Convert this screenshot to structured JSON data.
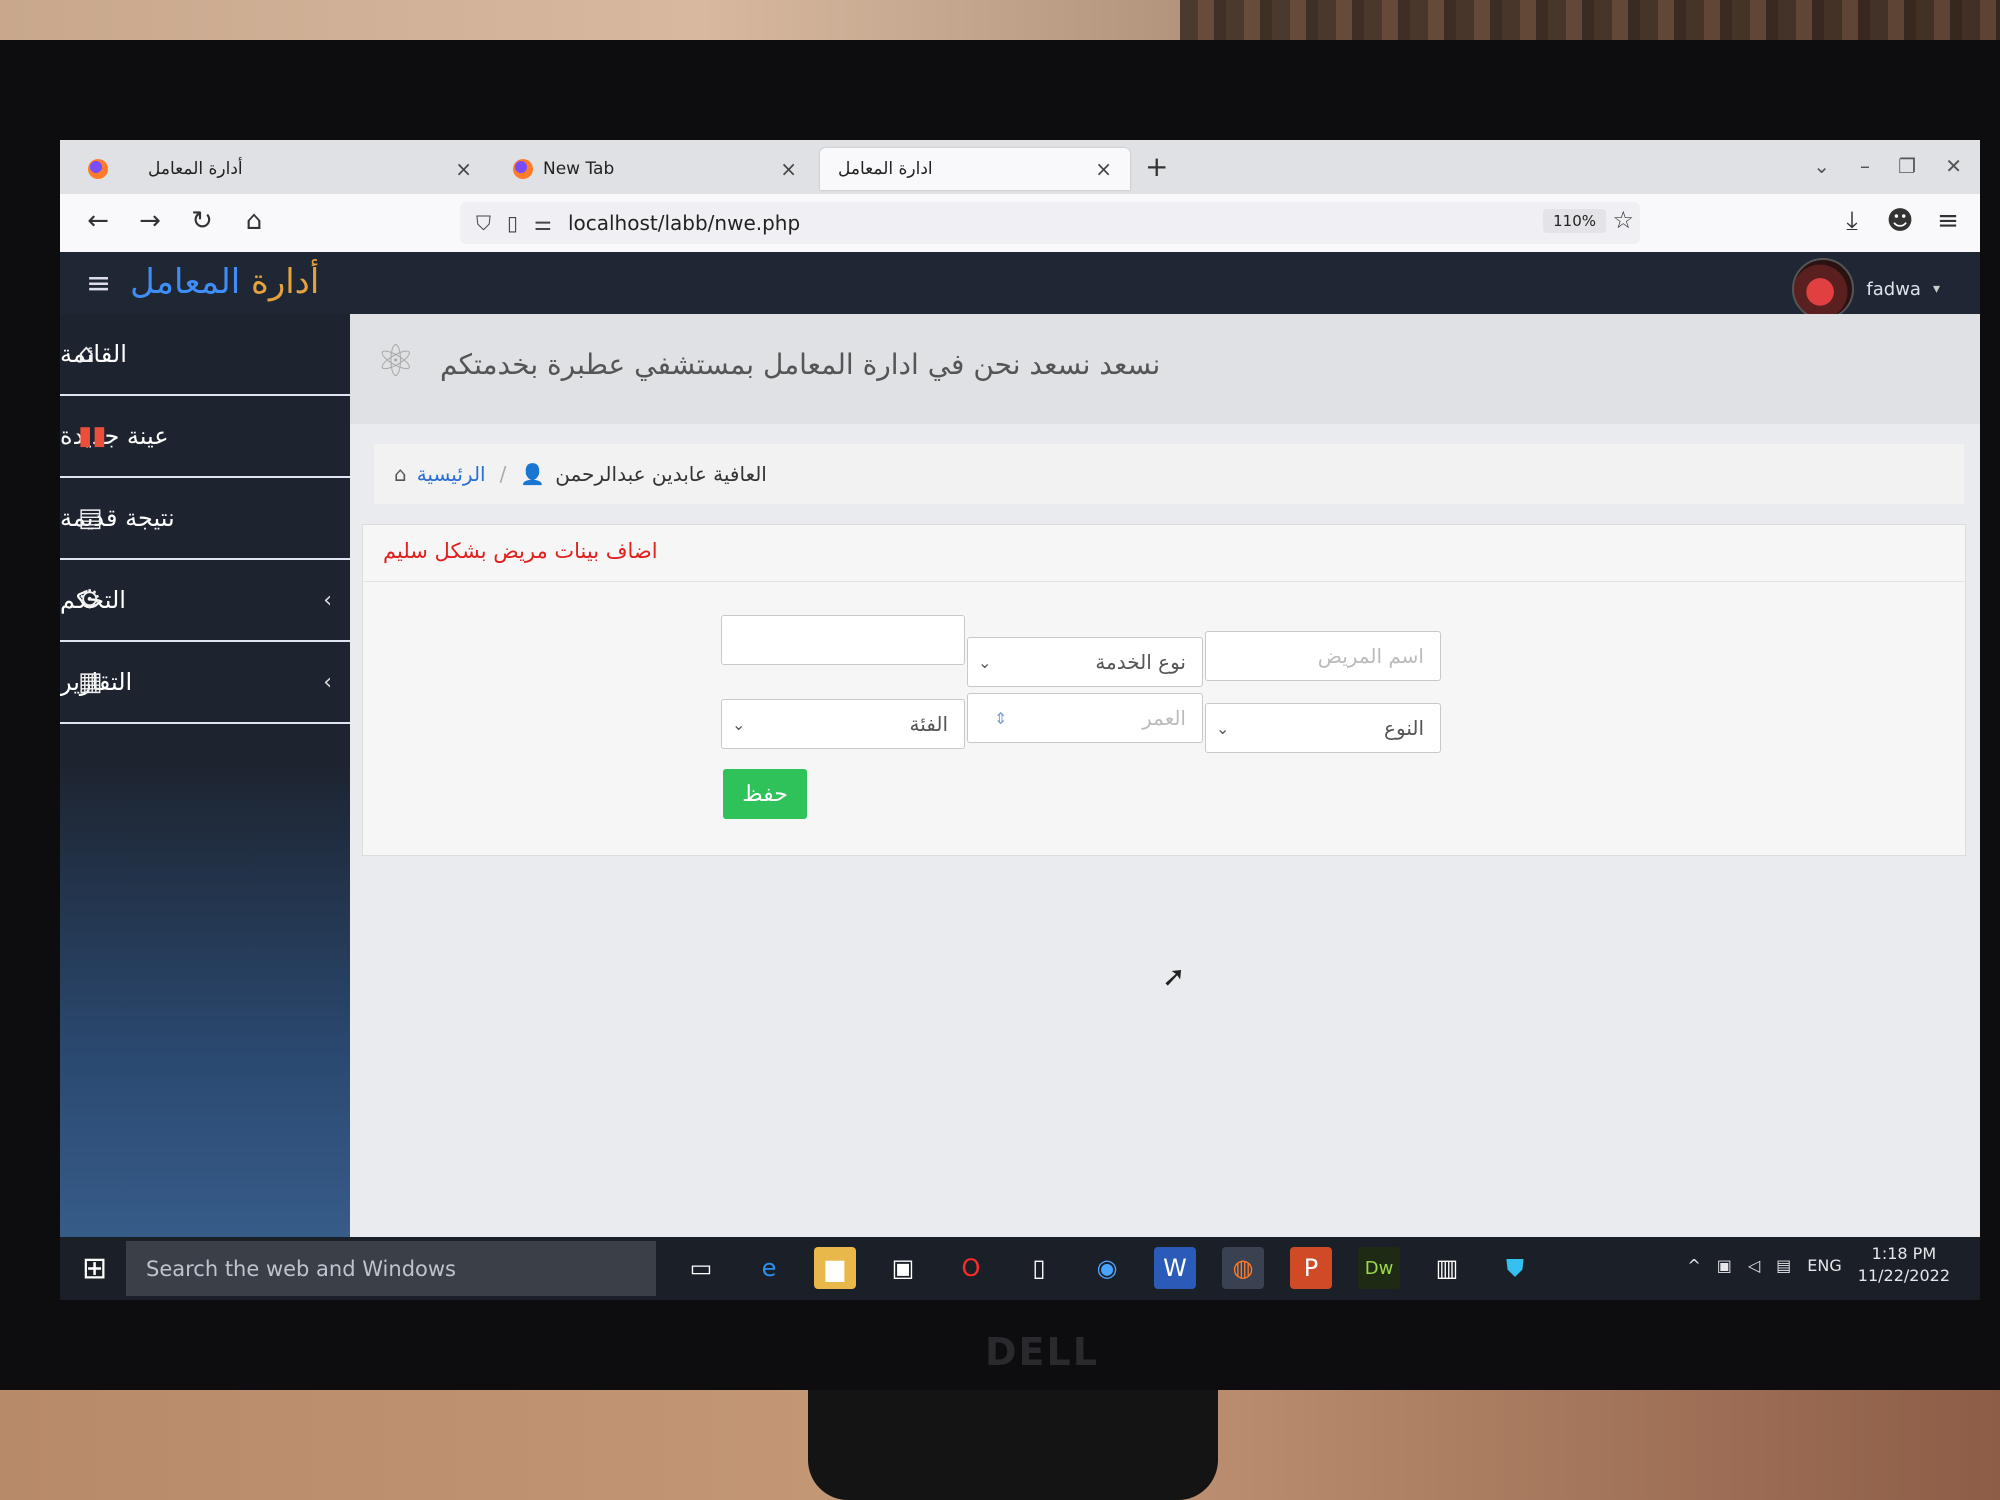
{
  "browser": {
    "tabs": [
      {
        "label": "أدارة المعامل"
      },
      {
        "label": "New Tab"
      },
      {
        "label": "ادارة المعامل"
      }
    ],
    "url": "localhost/labb/nwe.php",
    "zoom": "110%"
  },
  "app": {
    "title_part1": "أدارة",
    "title_part2": " المعامل",
    "username": "fadwa",
    "welcome": "نسعد نسعد نحن في ادارة المعامل بمستشفي عطبرة بخدمتكم"
  },
  "sidebar": {
    "items": [
      {
        "label": "القائمة",
        "icon": "home-icon"
      },
      {
        "label": "عينة جديدة",
        "icon": "chart-icon"
      },
      {
        "label": "نتيجة قديمة",
        "icon": "document-icon"
      },
      {
        "label": "التحكم",
        "icon": "gear-icon"
      },
      {
        "label": "التقارير",
        "icon": "report-icon"
      }
    ]
  },
  "breadcrumb": {
    "home": "الرئيسية",
    "current": "العافية عابدين عبدالرحمن"
  },
  "form": {
    "title": "اضاف بينات مريض بشكل سليم",
    "patient_name_placeholder": "اسم المريض",
    "service_type": "نوع الخدمة",
    "gender": "النوع",
    "age_placeholder": "العمر",
    "category": "الفئة",
    "save_label": "حفظ"
  },
  "taskbar": {
    "search_placeholder": "Search the web and Windows",
    "lang": "ENG",
    "time": "1:18 PM",
    "date": "11/22/2022"
  },
  "colors": {
    "header_bg": "#1f2735",
    "accent_blue": "#3f8ef7",
    "title_orange": "#e6a23c",
    "form_title_red": "#e0211e",
    "save_green": "#2fc15a"
  },
  "monitor": {
    "brand": "DELL"
  }
}
